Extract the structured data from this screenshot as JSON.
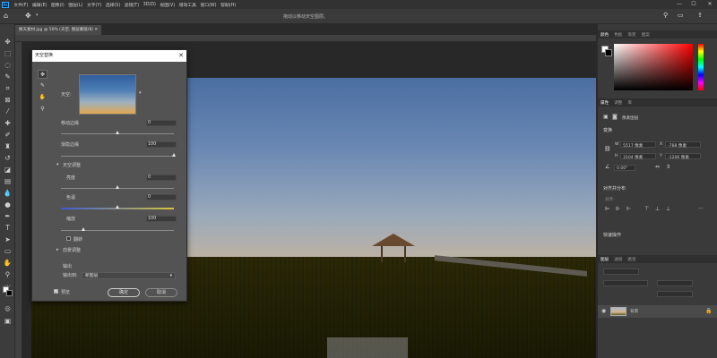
{
  "app": {
    "logo": "Ps",
    "menu": [
      "文件(F)",
      "编辑(E)",
      "图像(I)",
      "图层(L)",
      "文字(Y)",
      "选择(S)",
      "滤镜(T)",
      "3D(D)",
      "视图(V)",
      "增效工具",
      "窗口(W)",
      "帮助(H)"
    ],
    "window_controls": [
      "—",
      "☐",
      "✕"
    ]
  },
  "options_bar": {
    "move_tool_icon": "move-icon",
    "hint": "拖动以移动天空图层。"
  },
  "document": {
    "tab_label": "换天素材.jpg @ 50% (天空, 图层蒙版/8) ✕"
  },
  "sky_dialog": {
    "title": "天空替换",
    "close": "✕",
    "sky_label": "天空:",
    "shift_edge_label": "移动边缘",
    "shift_edge_value": "0",
    "shift_edge_level": 0.5,
    "fade_edge_label": "渐隐边缘",
    "fade_edge_value": "100",
    "fade_edge_level": 1.0,
    "sky_adjust_label": "天空调整",
    "brightness_label": "亮度",
    "brightness_value": "0",
    "brightness_level": 0.5,
    "temperature_label": "色温",
    "temperature_value": "0",
    "temperature_level": 0.5,
    "scale_label": "缩放",
    "scale_value": "100",
    "scale_level": 0.2,
    "flip_label": "翻转",
    "lighting_label": "前景调整",
    "output_label": "输出",
    "output_to_label": "输出到:",
    "output_to_value": "新图层",
    "preview_label": "预览",
    "ok_label": "确定",
    "cancel_label": "取消"
  },
  "panels": {
    "color_tabs": [
      "颜色",
      "色板",
      "渐变",
      "图案"
    ],
    "properties_tabs": [
      "属性",
      "调整",
      "库"
    ],
    "pixel_layer_label": "像素图层",
    "transform_label": "变换",
    "w_label": "W",
    "w_value": "5517 像素",
    "x_label": "X",
    "x_value": "-788 像素",
    "h_label": "H",
    "h_value": "3104 像素",
    "y_label": "Y",
    "y_value": "-1206 像素",
    "angle_value": "0.00°",
    "align_label": "对齐并分布",
    "align_sub": "对齐:",
    "quick_actions_label": "快速操作",
    "layers_tabs": [
      "图层",
      "通道",
      "路径"
    ],
    "layer_name": "背景"
  }
}
